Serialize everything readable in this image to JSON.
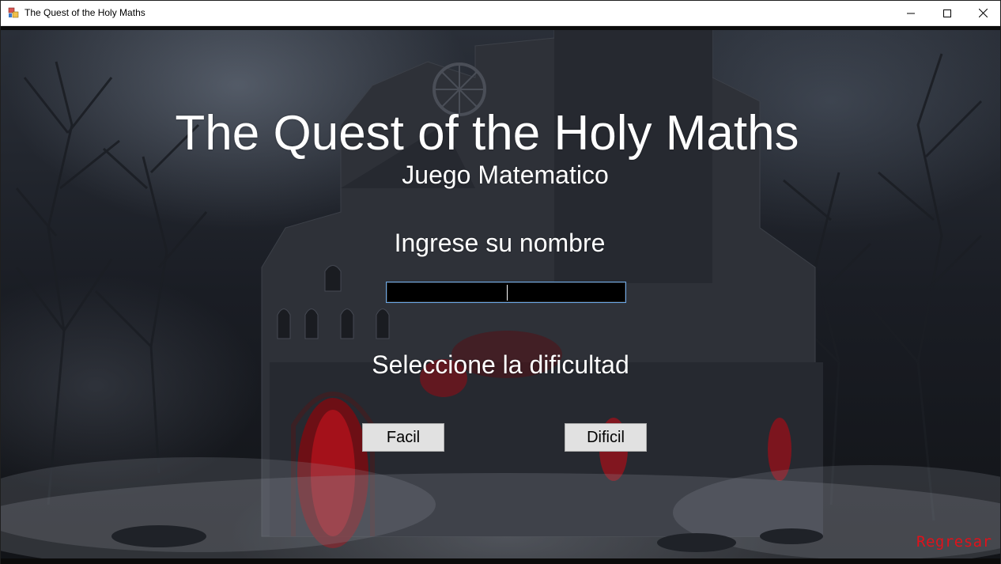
{
  "window": {
    "title": "The Quest of the Holy Maths",
    "controls": {
      "minimize": "─",
      "maximize": "☐",
      "close": "✕"
    }
  },
  "main": {
    "title": "The Quest of the Holy Maths",
    "subtitle": "Juego Matematico",
    "name_prompt": "Ingrese su nombre",
    "name_input": {
      "value": "",
      "placeholder": ""
    },
    "difficulty_prompt": "Seleccione la dificultad",
    "buttons": {
      "easy": "Facil",
      "hard": "Dificil"
    },
    "back_link": "Regresar"
  },
  "colors": {
    "text": "#ffffff",
    "back_link": "#e0121b",
    "input_border": "#6aa7e6",
    "button_bg": "#e1e1e1"
  },
  "icons": {
    "app": "app-window-icon"
  }
}
